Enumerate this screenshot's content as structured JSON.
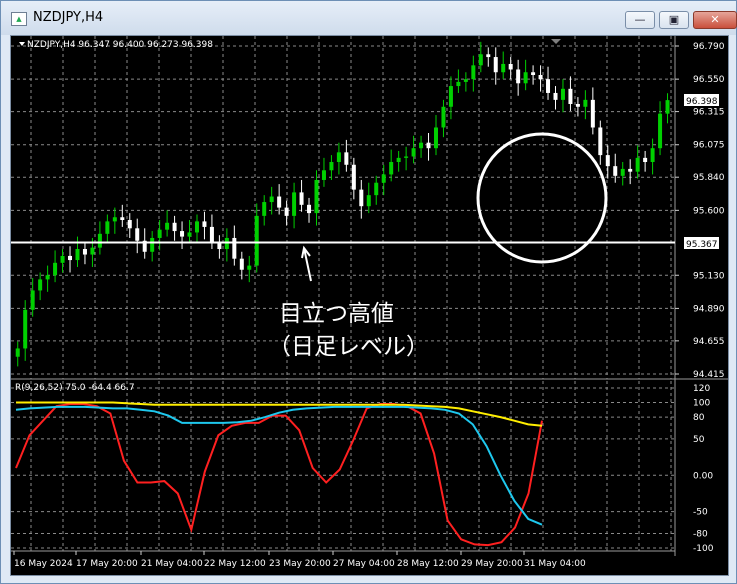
{
  "window": {
    "title": "NZDJPY,H4",
    "icon": "chart-app-icon",
    "buttons": [
      "minimize-icon",
      "restore-icon",
      "close-icon"
    ]
  },
  "chart": {
    "header": "NZDJPY,H4  96.347 96.400 96.273 96.398",
    "y_ticks": [
      "96.790",
      "96.550",
      "96.315",
      "96.075",
      "95.840",
      "95.600",
      "95.130",
      "94.890",
      "94.655",
      "94.415"
    ],
    "price_badge": "96.398",
    "line_badge": "95.367",
    "annotation_line1": "目立つ高値",
    "annotation_line2": "（日足レベル）"
  },
  "indicator": {
    "header": "R(9,26,52) 75.0 -64.4 66.7",
    "y_ticks": [
      "120",
      "100",
      "80",
      "50",
      "0.00",
      "-50",
      "-80",
      "-100"
    ]
  },
  "x_ticks": [
    "16 May 2024",
    "17 May 20:00",
    "21 May 04:00",
    "22 May 12:00",
    "23 May 20:00",
    "27 May 04:00",
    "28 May 12:00",
    "29 May 20:00",
    "31 May 04:00"
  ],
  "chart_data": [
    {
      "type": "candlestick",
      "symbol": "NZDJPY",
      "timeframe": "H4",
      "ohlc_last": {
        "open": 96.347,
        "high": 96.4,
        "low": 96.273,
        "close": 96.398
      },
      "ylim": [
        94.415,
        96.79
      ],
      "closes": [
        94.6,
        94.88,
        95.02,
        95.1,
        95.13,
        95.22,
        95.27,
        95.24,
        95.32,
        95.28,
        95.33,
        95.43,
        95.52,
        95.55,
        95.53,
        95.47,
        95.38,
        95.3,
        95.4,
        95.46,
        95.51,
        95.45,
        95.41,
        95.44,
        95.52,
        95.48,
        95.37,
        95.32,
        95.4,
        95.25,
        95.17,
        95.2,
        95.56,
        95.66,
        95.7,
        95.62,
        95.56,
        95.73,
        95.64,
        95.58,
        95.82,
        95.89,
        95.95,
        96.02,
        95.93,
        95.75,
        95.63,
        95.71,
        95.8,
        95.86,
        95.95,
        95.98,
        95.99,
        96.05,
        96.09,
        96.05,
        96.2,
        96.35,
        96.5,
        96.53,
        96.55,
        96.65,
        96.73,
        96.71,
        96.6,
        96.66,
        96.62,
        96.52,
        96.6,
        96.58,
        96.55,
        96.45,
        96.4,
        96.48,
        96.37,
        96.35,
        96.4,
        96.2,
        96.0,
        95.92,
        95.85,
        95.9,
        95.88,
        95.98,
        95.95,
        96.05,
        96.3,
        96.398
      ],
      "horizontal_line": 95.367,
      "annotations": [
        "目立つ高値",
        "（日足レベル）"
      ]
    },
    {
      "type": "line",
      "title": "R(9,26,52) 75.0 -64.4 66.7",
      "ylim": [
        -100,
        120
      ],
      "series": [
        {
          "color": "#ff2020",
          "values": [
            10,
            55,
            75,
            95,
            98,
            98,
            95,
            85,
            20,
            -10,
            -10,
            -8,
            -25,
            -75,
            5,
            55,
            68,
            72,
            72,
            82,
            82,
            62,
            10,
            -10,
            8,
            48,
            92,
            98,
            98,
            95,
            85,
            30,
            -62,
            -88,
            -95,
            -96,
            -92,
            -72,
            -25,
            75
          ]
        },
        {
          "color": "#1ec8ee",
          "values": [
            90,
            92,
            93,
            94,
            94,
            94,
            93,
            92,
            92,
            90,
            88,
            82,
            72,
            72,
            72,
            72,
            73,
            75,
            80,
            86,
            90,
            92,
            93,
            94,
            94,
            94,
            94,
            94,
            94,
            93,
            92,
            90,
            85,
            70,
            40,
            0,
            -35,
            -60,
            -68
          ]
        },
        {
          "color": "#ffee00",
          "values": [
            100,
            100,
            100,
            100,
            100,
            100,
            100,
            100,
            99,
            98,
            97,
            97,
            97,
            97,
            97,
            97,
            97,
            97,
            97,
            97,
            97,
            97,
            97,
            97,
            97,
            97,
            97,
            97,
            97,
            96,
            95,
            94,
            92,
            88,
            84,
            80,
            75,
            70,
            68
          ]
        }
      ]
    }
  ],
  "colors": {
    "background": "#000000",
    "grid": "#8a8a8a",
    "bull": "#00d000",
    "bear": "#ffffff",
    "accent": "#ffffff"
  }
}
